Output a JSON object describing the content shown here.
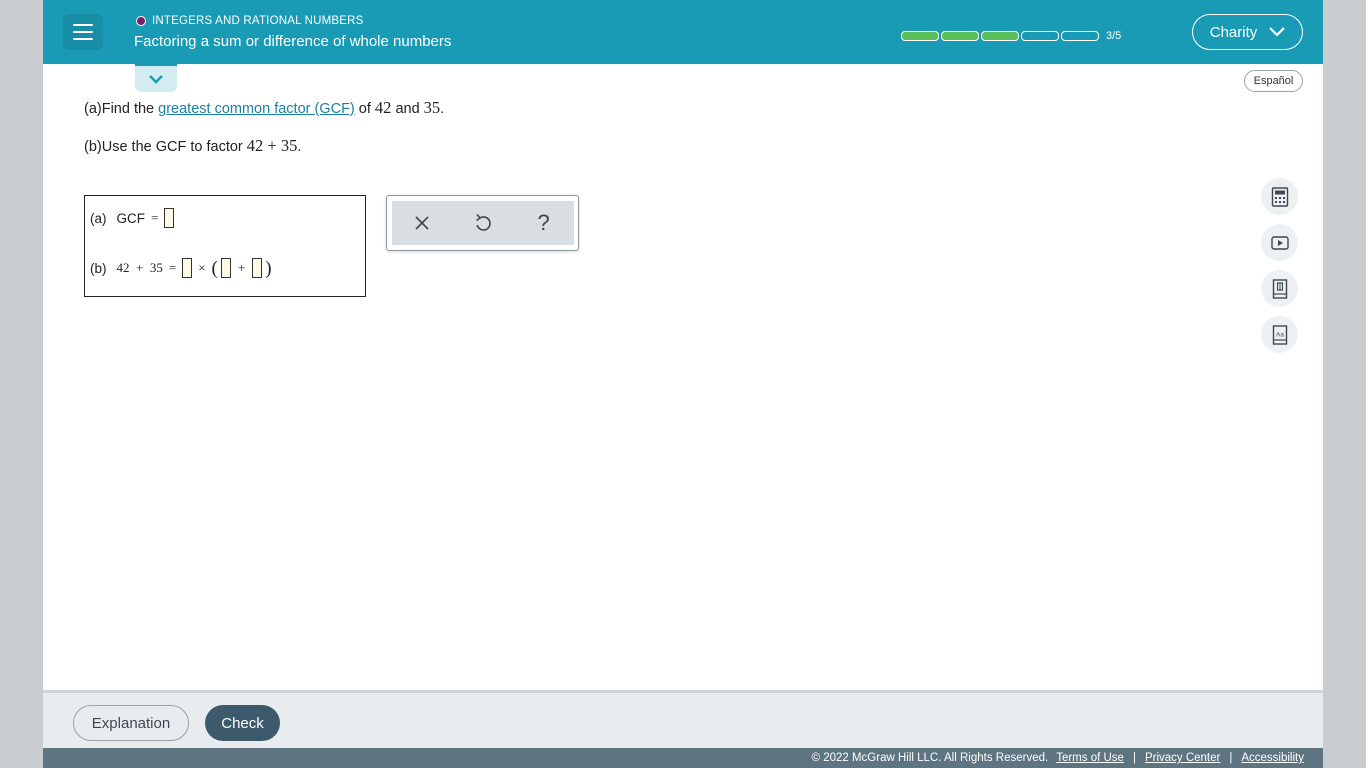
{
  "header": {
    "topic": "INTEGERS AND RATIONAL NUMBERS",
    "title": "Factoring a sum or difference of whole numbers",
    "progress": {
      "completed": 3,
      "total": 5,
      "label": "3/5"
    },
    "user_name": "Charity"
  },
  "language_button": "Español",
  "question": {
    "a_prefix": "(a)Find the ",
    "a_link": "greatest common factor (GCF)",
    "a_mid": " of ",
    "a_num1": "42",
    "a_and": " and ",
    "a_num2": "35",
    "a_end": ".",
    "b_prefix": "(b)Use the GCF to factor ",
    "b_expr": "42 + 35",
    "b_end": "."
  },
  "answer": {
    "a_label": "(a)",
    "a_text": "GCF",
    "eq": "=",
    "b_label": "(b)",
    "b_expr": "42  +  35",
    "times": "×",
    "open_paren": "(",
    "plus": "+",
    "close_paren": ")"
  },
  "tools": {
    "clear": "×",
    "undo": "↺",
    "help": "?"
  },
  "side_icons": [
    "calculator-icon",
    "video-icon",
    "ebook-icon",
    "dictionary-icon"
  ],
  "action_bar": {
    "explanation": "Explanation",
    "check": "Check"
  },
  "footer": {
    "copyright": "© 2022 McGraw Hill LLC. All Rights Reserved.",
    "terms": "Terms of Use",
    "privacy": "Privacy Center",
    "accessibility": "Accessibility",
    "separator": "|"
  },
  "colors": {
    "header": "#1a9bb5",
    "progress_fill": "#5bbf5b",
    "check_button": "#3c5a6b",
    "footer": "#5e7581",
    "topic_dot": "#7b1e6b"
  }
}
